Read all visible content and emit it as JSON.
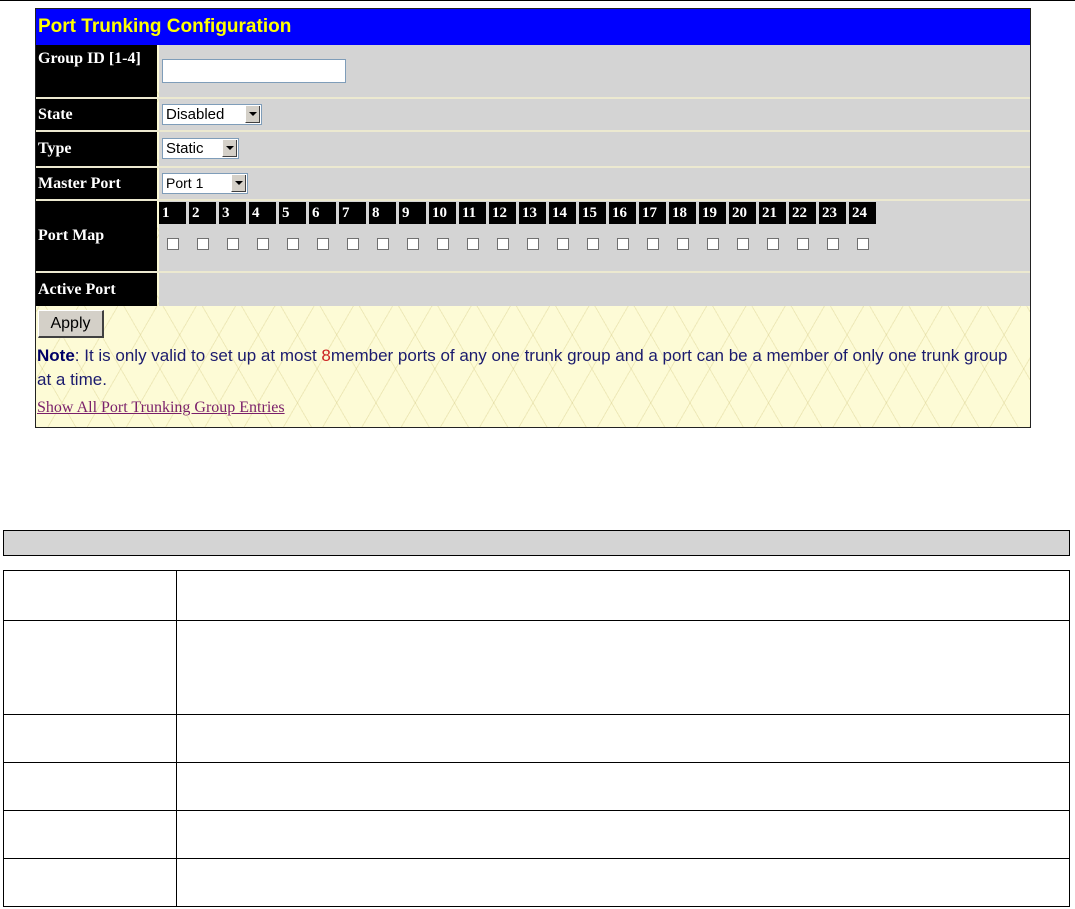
{
  "panel": {
    "title": "Port Trunking Configuration",
    "fields": {
      "group_id_label": "Group ID [1-4]",
      "group_id_value": "",
      "state_label": "State",
      "state_value": "Disabled",
      "type_label": "Type",
      "type_value": "Static",
      "master_port_label": "Master Port",
      "master_port_value": "Port 1",
      "port_map_label": "Port Map",
      "active_port_label": "Active Port"
    },
    "ports": [
      "1",
      "2",
      "3",
      "4",
      "5",
      "6",
      "7",
      "8",
      "9",
      "10",
      "11",
      "12",
      "13",
      "14",
      "15",
      "16",
      "17",
      "18",
      "19",
      "20",
      "21",
      "22",
      "23",
      "24"
    ],
    "apply_label": "Apply",
    "note": {
      "label": "Note",
      "text_before": ": It is only valid to set up at most ",
      "number": "8",
      "text_after": "member ports of any one trunk group and a port can be a member of only one trunk group at a time."
    },
    "show_link": "Show All Port Trunking Group Entries"
  },
  "colors": {
    "title_bg": "#0000ff",
    "title_text": "#ffff00",
    "label_bg": "#000000",
    "field_bg": "#d4d4d4",
    "panel_bg": "#fdfbd6",
    "note_number": "#cc2222",
    "link": "#7a1f6a"
  }
}
